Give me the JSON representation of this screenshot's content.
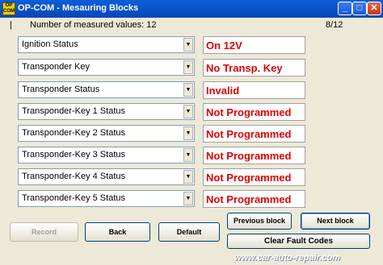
{
  "window": {
    "title": "OP-COM - Mesauring Blocks",
    "icon_label": "OP COM",
    "minimize_glyph": "_",
    "maximize_glyph": "□",
    "close_glyph": "✕"
  },
  "header": {
    "indicator": "|",
    "count_text": "Number of measured values: 12",
    "page_text": "8/12"
  },
  "rows": [
    {
      "label": "Ignition Status",
      "value": "On  12V"
    },
    {
      "label": "Transponder Key",
      "value": "No Transp. Key"
    },
    {
      "label": "Transponder Status",
      "value": "Invalid"
    },
    {
      "label": "Transponder-Key 1 Status",
      "value": "Not Programmed"
    },
    {
      "label": "Transponder-Key 2 Status",
      "value": "Not Programmed"
    },
    {
      "label": "Transponder-Key 3 Status",
      "value": "Not Programmed"
    },
    {
      "label": "Transponder-Key 4 Status",
      "value": "Not Programmed"
    },
    {
      "label": "Transponder-Key 5 Status",
      "value": "Not Programmed"
    }
  ],
  "dropdown_glyph": "▼",
  "buttons": {
    "record": "Record",
    "back": "Back",
    "default": "Default",
    "previous_block": "Previous block",
    "next_block": "Next block",
    "clear_fault_codes": "Clear Fault Codes"
  },
  "watermark": "www.car-auto-repair.com",
  "colors": {
    "value_text": "#e00000",
    "titlebar": "#0a5fd8"
  }
}
